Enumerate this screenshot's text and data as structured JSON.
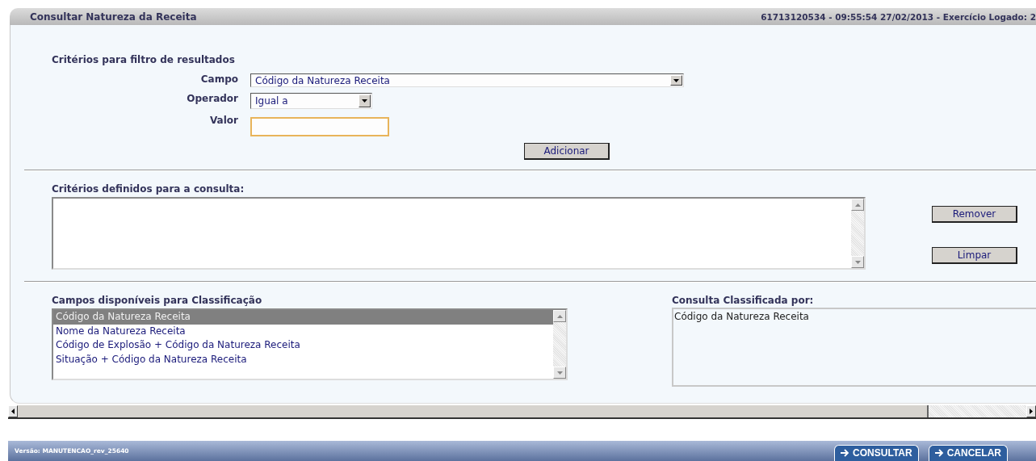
{
  "window": {
    "title": "Consultar Natureza da Receita",
    "session_info": "61713120534 - 09:55:54 27/02/2013 - Exercício Logado: 2"
  },
  "filter": {
    "heading": "Critérios para filtro de resultados",
    "fields": [
      {
        "kind": "select",
        "label": "Campo",
        "value": "Código da Natureza Receita"
      },
      {
        "kind": "select",
        "label": "Operador",
        "value": "Igual a"
      },
      {
        "kind": "text",
        "label": "Valor",
        "focused": true
      }
    ],
    "add_button": "Adicionar"
  },
  "criteria": {
    "heading": "Critérios definidos para a consulta:",
    "buttons": [
      "Remover",
      "Limpar"
    ]
  },
  "sort_fields": {
    "heading": "Campos disponíveis para Classificação",
    "items": [
      {
        "label": "Código da Natureza Receita",
        "selected": true
      },
      {
        "label": "Nome da Natureza Receita",
        "selected": false
      },
      {
        "label": "Código de Explosão + Código da Natureza Receita",
        "selected": false
      },
      {
        "label": "Situação + Código da Natureza Receita",
        "selected": false
      }
    ]
  },
  "sorted_by": {
    "heading": "Consulta Classificada por:",
    "items": [
      "Código da Natureza Receita"
    ]
  },
  "footer": {
    "version": "Versão: MANUTENCAO_rev_25640",
    "buttons": [
      "CONSULTAR",
      "CANCELAR"
    ]
  }
}
